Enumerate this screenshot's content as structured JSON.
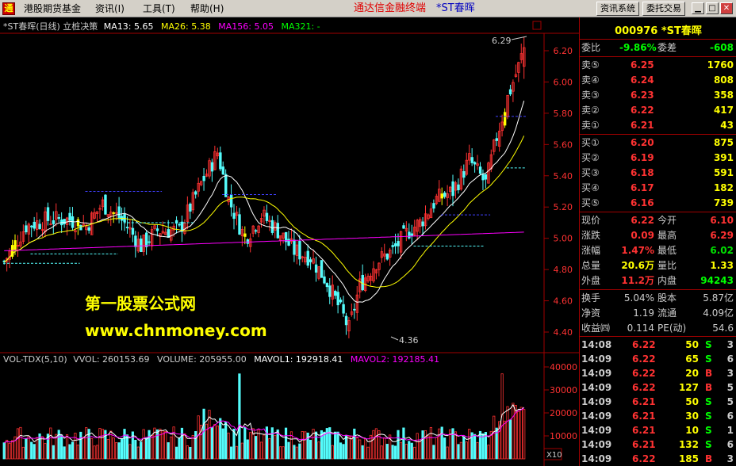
{
  "menubar": {
    "items": [
      "港股期货基金",
      "资讯(I)",
      "工具(T)",
      "帮助(H)"
    ],
    "title": "通达信金融终端",
    "stock": "*ST春晖",
    "btn_info_sys": "资讯系统",
    "btn_order": "委托交易"
  },
  "chart_header": {
    "name": "*ST春晖(日线)",
    "indicator": "立桩决策",
    "ma13": "MA13: 5.65",
    "ma26": "MA26: 5.38",
    "ma156": "MA156: 5.05",
    "ma321": "MA321: -"
  },
  "vol_header": {
    "name": "VOL-TDX(5,10)",
    "vvol": "VVOL: 260153.69",
    "volume": "VOLUME: 205955.00",
    "mavol1": "MAVOL1: 192918.41",
    "mavol2": "MAVOL2: 192185.41"
  },
  "annotations": {
    "high": "6.29",
    "low": "4.36"
  },
  "watermark": {
    "line1": "第一股票公式网",
    "line2": "www.chnmoney.com"
  },
  "y_axis_price": [
    "6.20",
    "6.00",
    "5.80",
    "5.60",
    "5.40",
    "5.20",
    "5.00",
    "4.80",
    "4.60",
    "4.40"
  ],
  "y_axis_vol": [
    "40000",
    "30000",
    "20000",
    "10000"
  ],
  "vol_unit": "X10",
  "colors": {
    "up": "#ff3232",
    "down": "#54fcfc",
    "ma13": "#ffffff",
    "ma26": "#ffff00",
    "ma156": "#ff00ff",
    "vol_ma1": "#ffffff",
    "vol_ma2": "#ff00ff"
  },
  "quote": {
    "code_name": "000976 *ST春晖",
    "weibi_label": "委比",
    "weibi": "-9.86%",
    "weicha_label": "委差",
    "weicha": "-608",
    "asks": [
      {
        "label": "卖⑤",
        "price": "6.25",
        "vol": "1760"
      },
      {
        "label": "卖④",
        "price": "6.24",
        "vol": "808"
      },
      {
        "label": "卖③",
        "price": "6.23",
        "vol": "358"
      },
      {
        "label": "卖②",
        "price": "6.22",
        "vol": "417"
      },
      {
        "label": "卖①",
        "price": "6.21",
        "vol": "43"
      }
    ],
    "bids": [
      {
        "label": "买①",
        "price": "6.20",
        "vol": "875"
      },
      {
        "label": "买②",
        "price": "6.19",
        "vol": "391"
      },
      {
        "label": "买③",
        "price": "6.18",
        "vol": "591"
      },
      {
        "label": "买④",
        "price": "6.17",
        "vol": "182"
      },
      {
        "label": "买⑤",
        "price": "6.16",
        "vol": "739"
      }
    ],
    "stats": [
      {
        "l1": "现价",
        "v1": "6.22",
        "l2": "今开",
        "v2": "6.10"
      },
      {
        "l1": "涨跌",
        "v1": "0.09",
        "l2": "最高",
        "v2": "6.29"
      },
      {
        "l1": "涨幅",
        "v1": "1.47%",
        "l2": "最低",
        "v2": "6.02"
      },
      {
        "l1": "总量",
        "v1": "20.6万",
        "l2": "量比",
        "v2": "1.33"
      },
      {
        "l1": "外盘",
        "v1": "11.2万",
        "l2": "内盘",
        "v2": "94243"
      }
    ],
    "finance": [
      {
        "l1": "换手",
        "v1": "5.04%",
        "l2": "股本",
        "v2": "5.87亿"
      },
      {
        "l1": "净资",
        "v1": "1.19",
        "l2": "流通",
        "v2": "4.09亿"
      },
      {
        "l1": "收益㈣",
        "v1": "0.114",
        "l2": "PE(动)",
        "v2": "54.6"
      }
    ],
    "ticks": [
      {
        "time": "14:08",
        "price": "6.22",
        "vol": "50",
        "side": "S",
        "n": "3"
      },
      {
        "time": "14:09",
        "price": "6.22",
        "vol": "65",
        "side": "S",
        "n": "6"
      },
      {
        "time": "14:09",
        "price": "6.22",
        "vol": "20",
        "side": "B",
        "n": "3"
      },
      {
        "time": "14:09",
        "price": "6.22",
        "vol": "127",
        "side": "B",
        "n": "5"
      },
      {
        "time": "14:09",
        "price": "6.21",
        "vol": "50",
        "side": "S",
        "n": "5"
      },
      {
        "time": "14:09",
        "price": "6.21",
        "vol": "30",
        "side": "S",
        "n": "6"
      },
      {
        "time": "14:09",
        "price": "6.21",
        "vol": "10",
        "side": "S",
        "n": "1"
      },
      {
        "time": "14:09",
        "price": "6.21",
        "vol": "132",
        "side": "S",
        "n": "6"
      },
      {
        "time": "14:09",
        "price": "6.22",
        "vol": "185",
        "side": "B",
        "n": "3"
      }
    ]
  }
}
